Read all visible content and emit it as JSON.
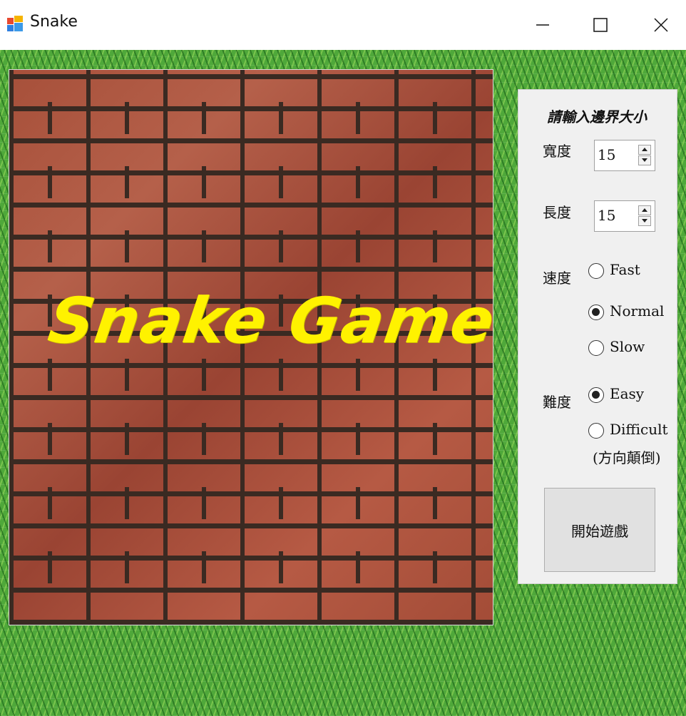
{
  "window": {
    "title": "Snake",
    "icon": "windows-forms-app-icon",
    "controls": [
      "minimize-icon",
      "maximize-icon",
      "close-icon"
    ]
  },
  "wall": {
    "title": "Snake Game",
    "title_color": "#fff200"
  },
  "panel": {
    "heading": "請輸入邊界大小",
    "width_label": "寬度",
    "width_value": "15",
    "length_label": "長度",
    "length_value": "15",
    "speed_label": "速度",
    "speed_options": [
      {
        "label": "Fast",
        "checked": false
      },
      {
        "label": "Normal",
        "checked": true
      },
      {
        "label": "Slow",
        "checked": false
      }
    ],
    "difficulty_label": "難度",
    "difficulty_options": [
      {
        "label": "Easy",
        "checked": true
      },
      {
        "label": "Difficult",
        "checked": false
      }
    ],
    "difficulty_note": "(方向顛倒)",
    "start_button": "開始遊戲"
  },
  "colors": {
    "grass": "#4fa83a",
    "panel": "#f0f0f0",
    "button": "#e1e1e1"
  }
}
